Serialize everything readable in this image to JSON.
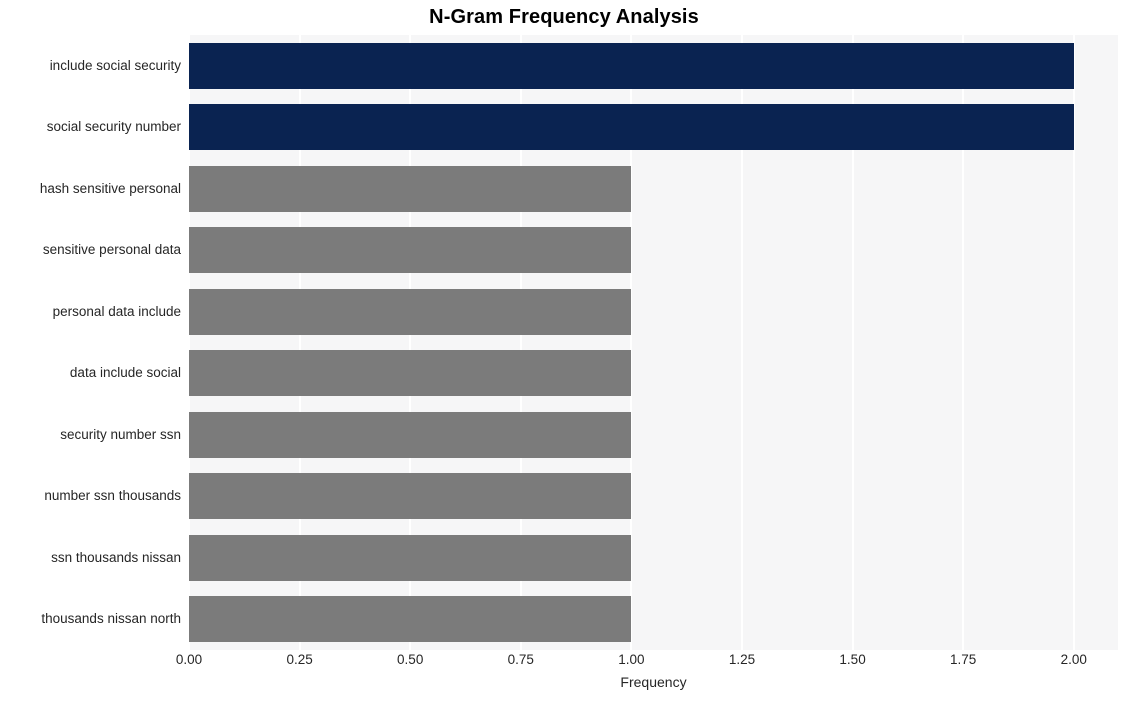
{
  "chart_data": {
    "type": "bar",
    "orientation": "horizontal",
    "title": "N-Gram Frequency Analysis",
    "xlabel": "Frequency",
    "ylabel": "",
    "categories": [
      "include social security",
      "social security number",
      "hash sensitive personal",
      "sensitive personal data",
      "personal data include",
      "data include social",
      "security number ssn",
      "number ssn thousands",
      "ssn thousands nissan",
      "thousands nissan north"
    ],
    "values": [
      2,
      2,
      1,
      1,
      1,
      1,
      1,
      1,
      1,
      1
    ],
    "bar_colors": [
      "#0a2351",
      "#0a2351",
      "#7b7b7b",
      "#7b7b7b",
      "#7b7b7b",
      "#7b7b7b",
      "#7b7b7b",
      "#7b7b7b",
      "#7b7b7b",
      "#7b7b7b"
    ],
    "xlim": [
      0,
      2.1
    ],
    "xticks": [
      0,
      0.25,
      0.5,
      0.75,
      1.0,
      1.25,
      1.5,
      1.75,
      2.0
    ],
    "xtick_labels": [
      "0.00",
      "0.25",
      "0.50",
      "0.75",
      "1.00",
      "1.25",
      "1.50",
      "1.75",
      "2.00"
    ],
    "grid": {
      "vertical": true,
      "horizontal": false,
      "color": "#ffffff"
    },
    "legend": null,
    "plot_background": "#f6f6f7",
    "figure_background": "#ffffff",
    "highlight_color": "#0a2351",
    "base_color": "#7b7b7b"
  }
}
